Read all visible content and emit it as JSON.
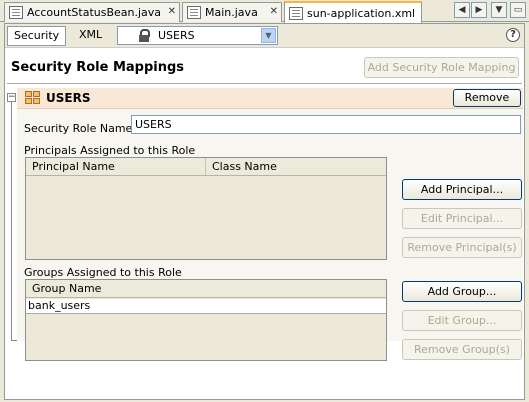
{
  "editor_tabs": [
    {
      "label": "AccountStatusBean.java"
    },
    {
      "label": "Main.java"
    },
    {
      "label": "sun-application.xml"
    }
  ],
  "view_tabs": {
    "security": "Security",
    "xml": "XML"
  },
  "role_selector": {
    "value": "USERS"
  },
  "page_title": "Security Role Mappings",
  "add_mapping_label": "Add Security Role Mapping",
  "role": {
    "title": "USERS",
    "remove_label": "Remove",
    "name_label": "Security Role Name :",
    "name_value": "USERS"
  },
  "principals": {
    "heading": "Principals Assigned to this Role",
    "columns": [
      "Principal Name",
      "Class Name"
    ],
    "rows": [],
    "add_label": "Add Principal...",
    "edit_label": "Edit Principal...",
    "remove_label": "Remove Principal(s)"
  },
  "groups": {
    "heading": "Groups Assigned to this Role",
    "columns": [
      "Group Name"
    ],
    "rows": [
      "bank_users"
    ],
    "add_label": "Add Group...",
    "edit_label": "Edit Group...",
    "remove_label": "Remove Group(s)"
  }
}
